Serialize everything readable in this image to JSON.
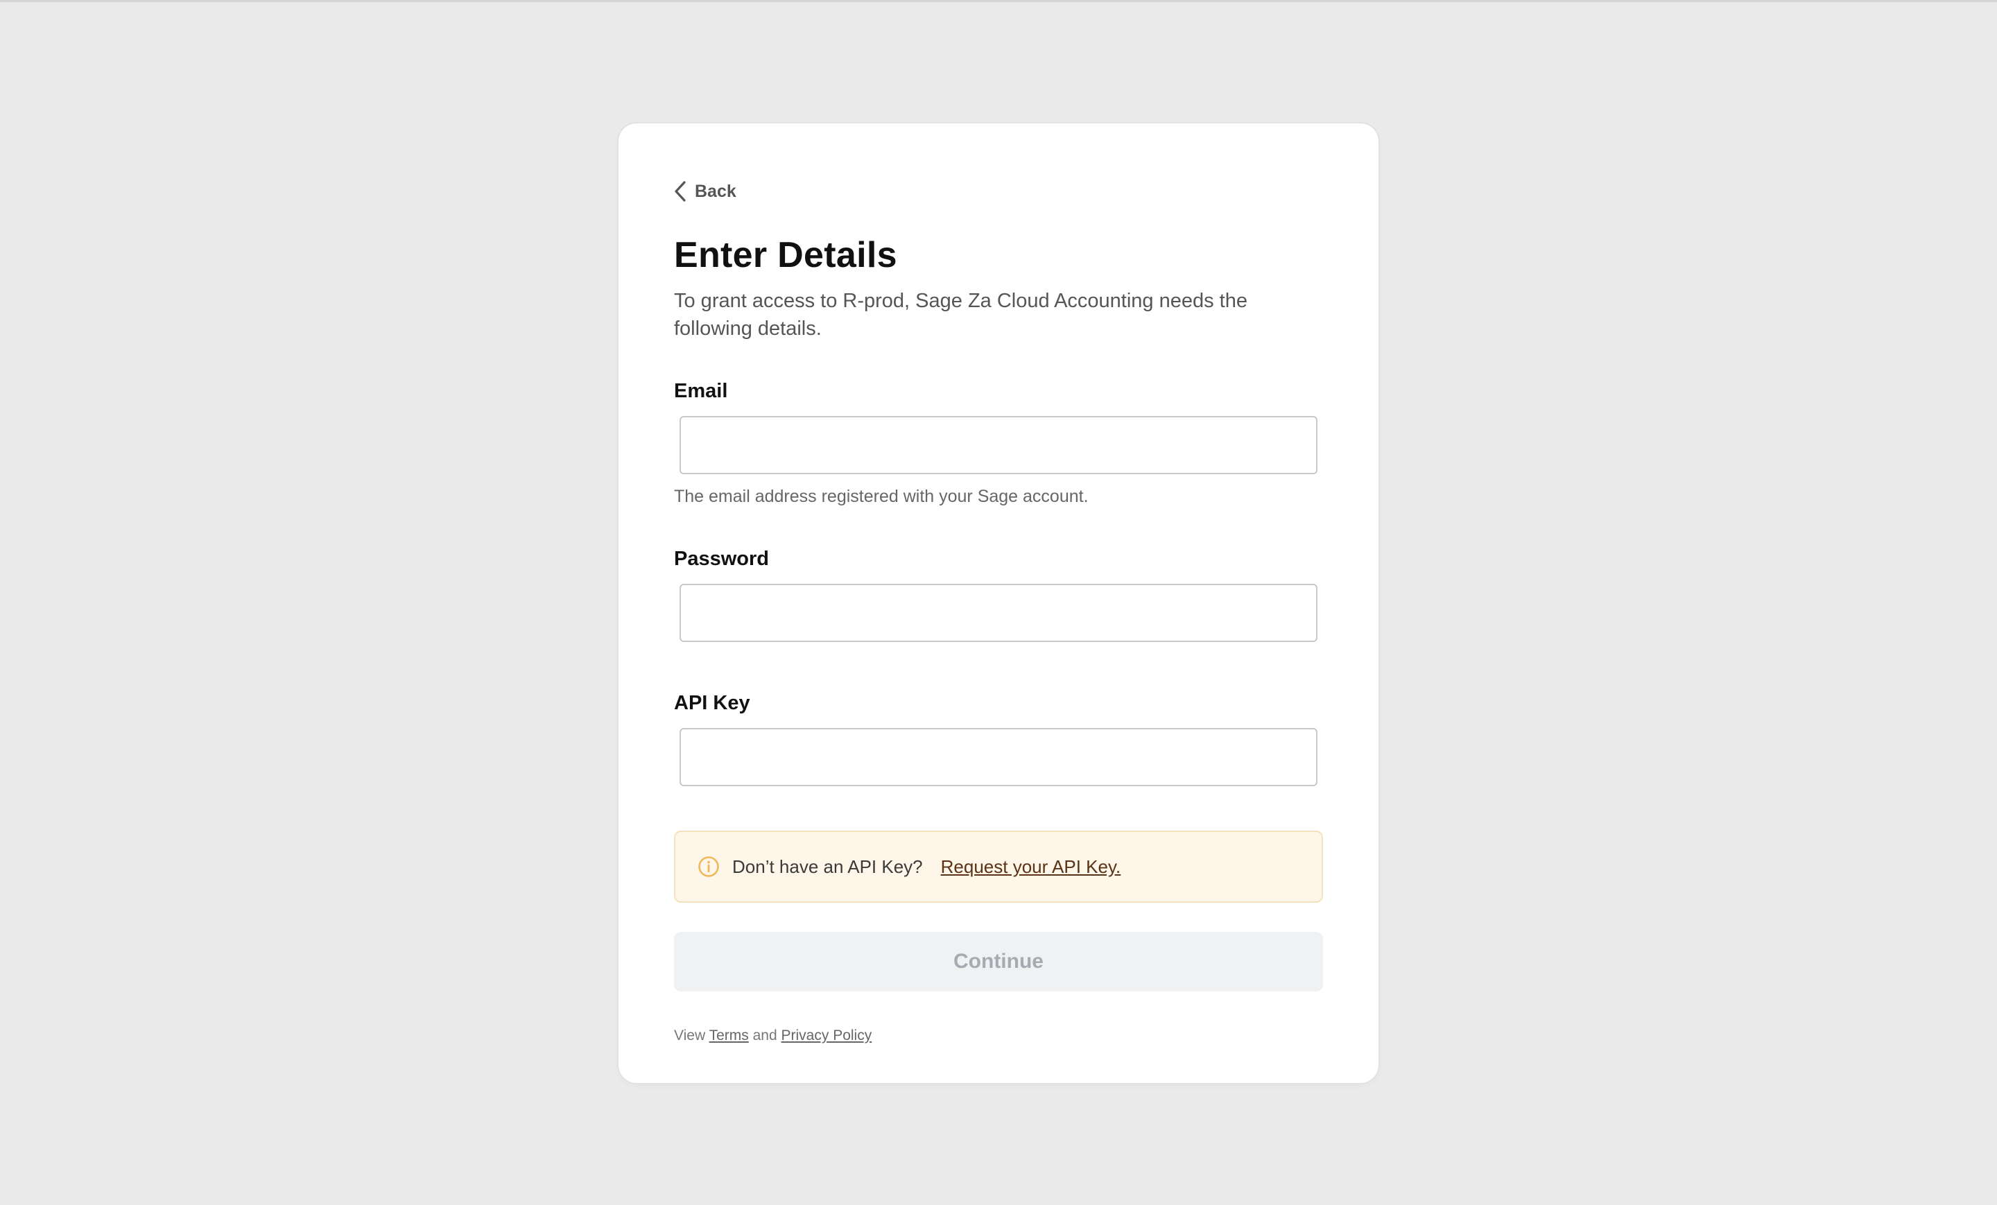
{
  "colors": {
    "page_background": "#eaeaea",
    "card_background": "#ffffff",
    "notice_background": "#fff6ea",
    "notice_border": "#f6e1bd",
    "notice_icon": "#f0b85a",
    "button_disabled_background": "#f0f1f3",
    "button_disabled_text": "#a7abb1"
  },
  "nav": {
    "back_label": "Back",
    "back_icon": "chevron-left-icon"
  },
  "header": {
    "title": "Enter Details",
    "subtitle": "To grant access to R-prod, Sage Za Cloud Accounting needs the following details."
  },
  "form": {
    "email": {
      "label": "Email",
      "value": "",
      "placeholder": "",
      "hint": "The email address registered with your Sage account."
    },
    "password": {
      "label": "Password",
      "value": "",
      "placeholder": ""
    },
    "api_key": {
      "label": "API Key",
      "value": "",
      "placeholder": ""
    }
  },
  "notice": {
    "icon": "info-icon",
    "text": "Don’t have an API Key?",
    "link": "Request your API Key."
  },
  "actions": {
    "continue_label": "Continue",
    "continue_disabled": true
  },
  "footer": {
    "prefix": "View",
    "terms_link": "Terms",
    "conjunction": "and",
    "privacy_link": "Privacy Policy"
  }
}
